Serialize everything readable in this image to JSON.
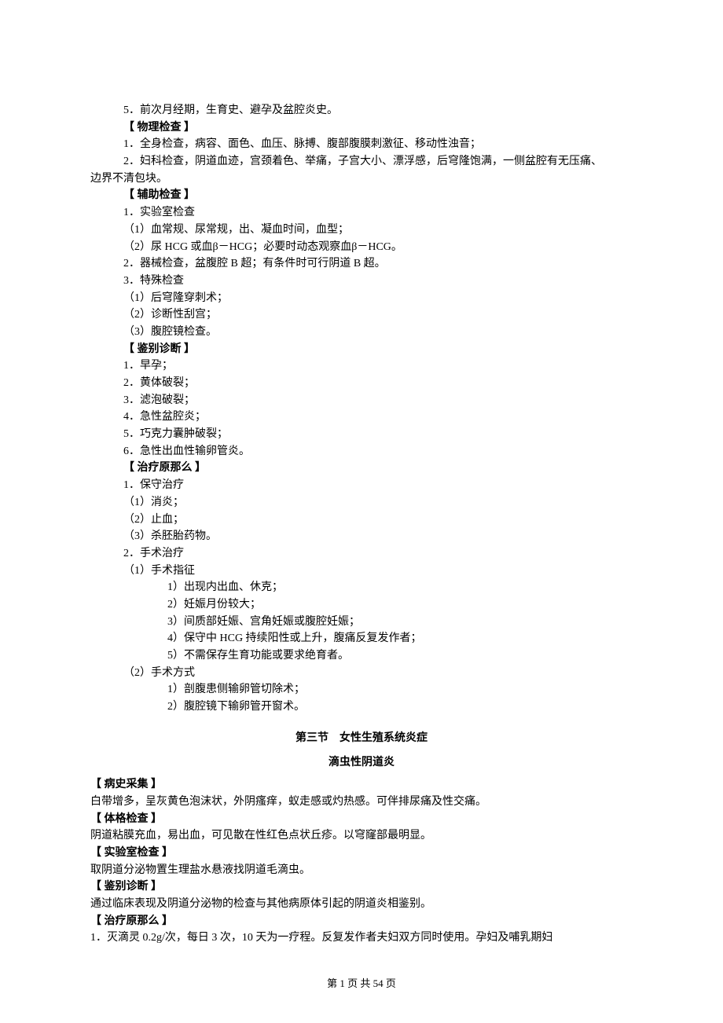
{
  "lines": {
    "l1": "5．前次月经期，生育史、避孕及盆腔炎史。",
    "l2": "【 物理检查 】",
    "l3": "1．全身检查，病容、面色、血压、脉搏、腹部腹膜刺激征、移动性浊音；",
    "l4": "2．妇科检查，阴道血迹，宫颈着色、举痛，子宫大小、漂浮感，后穹隆饱满，一侧盆腔有无压痛、",
    "l4b": "边界不清包块。",
    "l5": "【 辅助检查 】",
    "l6": "1．实验室检查",
    "l7": "（1）血常规、尿常规，出、凝血时间，血型；",
    "l8": "（2）尿 HCG 或血β－HCG；必要时动态观察血β－HCG。",
    "l9": "2．器械检查，盆腹腔 B 超；有条件时可行阴道 B 超。",
    "l10": "3．特殊检查",
    "l11": "（1）后穹隆穿刺术；",
    "l12": "（2）诊断性刮宫；",
    "l13": "（3）腹腔镜检查。",
    "l14": "【 鉴别诊断 】",
    "l15": "1．早孕；",
    "l16": "2．黄体破裂；",
    "l17": "3．滤泡破裂；",
    "l18": "4．急性盆腔炎；",
    "l19": "5．巧克力囊肿破裂；",
    "l20": "6．急性出血性输卵管炎。",
    "l21": "【 治疗原那么 】",
    "l22": "1．保守治疗",
    "l23": "（1）消炎；",
    "l24": "（2）止血；",
    "l25": "（3）杀胚胎药物。",
    "l26": "2．手术治疗",
    "l27": "（1）手术指征",
    "l28": "1）出现内出血、休克；",
    "l29": "2）妊娠月份较大；",
    "l30": "3）间质部妊娠、宫角妊娠或腹腔妊娠；",
    "l31": "4）保守中 HCG 持续阳性或上升，腹痛反复发作者；",
    "l32": "5）不需保存生育功能或要求绝育者。",
    "l33": "（2）手术方式",
    "l34": "1）剖腹患侧输卵管切除术；",
    "l35": "2）腹腔镜下输卵管开窗术。"
  },
  "section3_title": "第三节　女性生殖系统炎症",
  "subsection_title": "滴虫性阴道炎",
  "sec3": {
    "h1": "【 病史采集 】",
    "p1": "白带增多，呈灰黄色泡沫状，外阴瘙痒，蚁走感或灼热感。可伴排尿痛及性交痛。",
    "h2": "【 体格检查 】",
    "p2": "阴道粘膜充血，易出血，可见散在性红色点状丘疹。以穹窿部最明显。",
    "h3": "【 实验室检查 】",
    "p3": "取阴道分泌物置生理盐水悬液找阴道毛滴虫。",
    "h4": "【 鉴别诊断 】",
    "p4": "通过临床表现及阴道分泌物的检查与其他病原体引起的阴道炎相鉴别。",
    "h5": "【 治疗原那么 】",
    "p5": "1．灭滴灵 0.2g/次，每日 3 次，10 天为一疗程。反复发作者夫妇双方同时使用。孕妇及哺乳期妇"
  },
  "footer": "第 1 页 共 54 页"
}
